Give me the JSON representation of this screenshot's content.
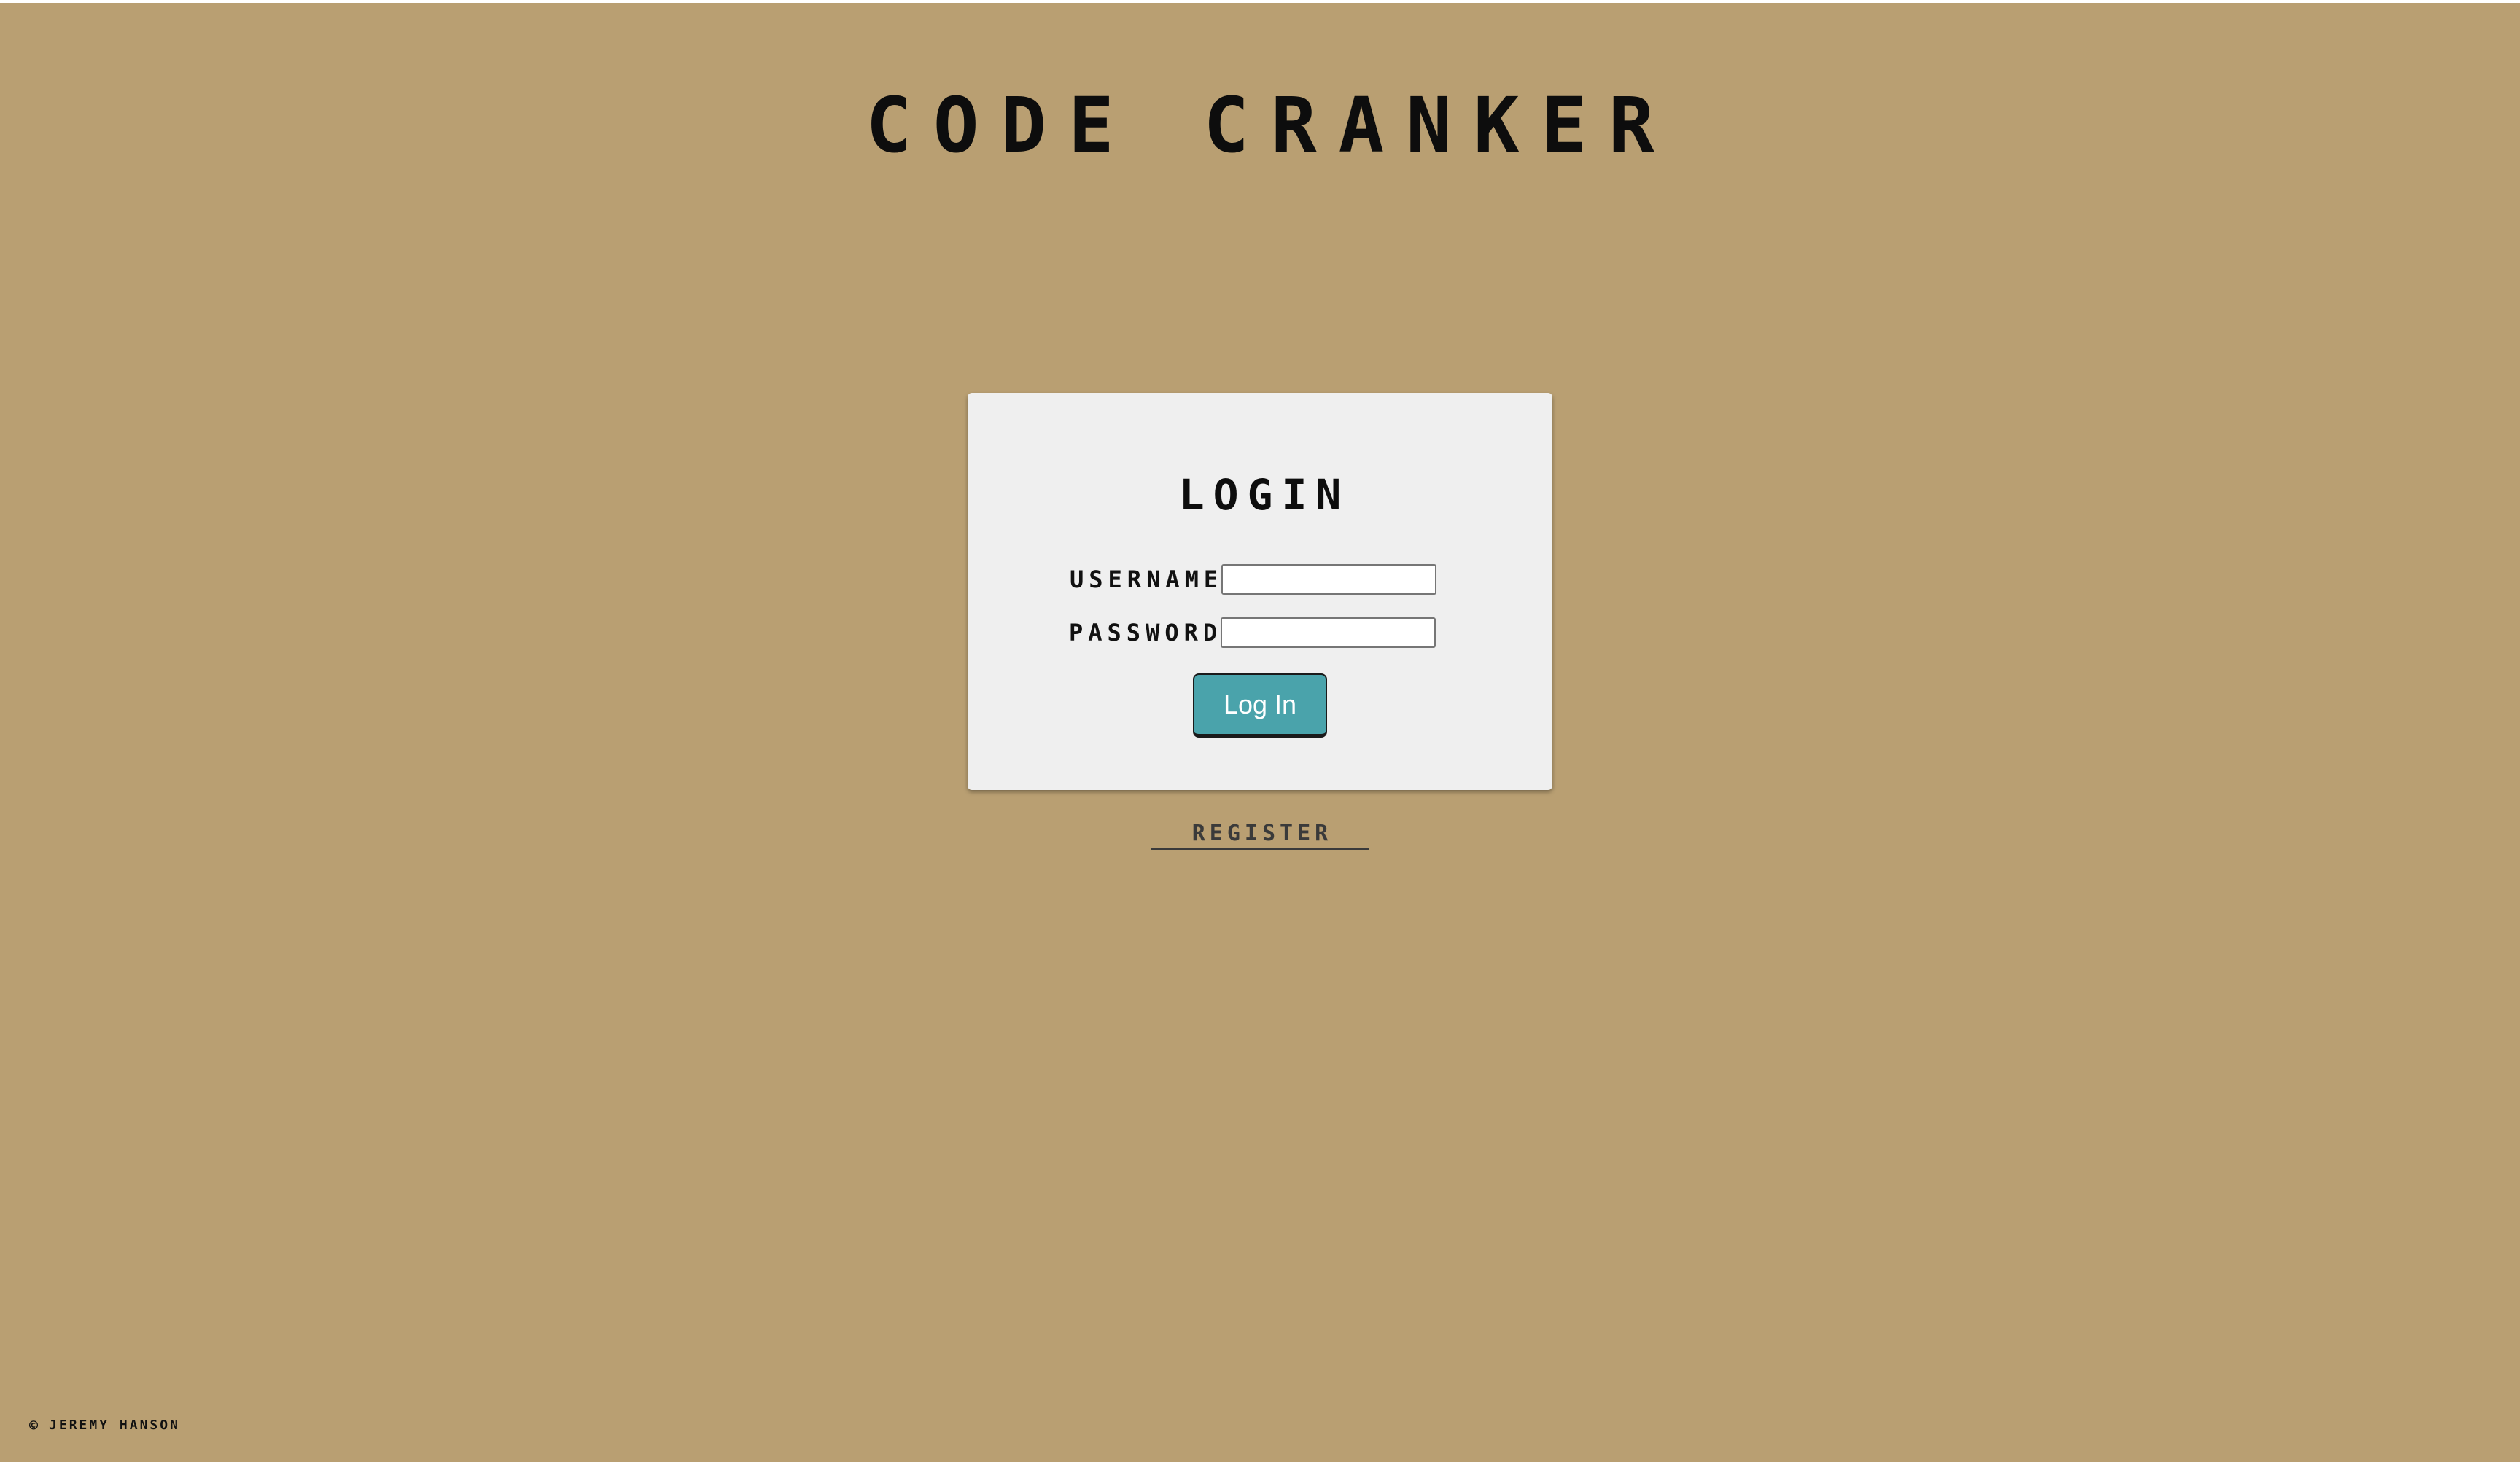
{
  "header": {
    "title": "CODE CRANKER"
  },
  "login": {
    "heading": "LOGIN",
    "username_label": "USERNAME:",
    "username_value": "",
    "password_label": "PASSWORD:",
    "password_value": "",
    "submit_label": "Log In"
  },
  "register": {
    "label": "REGISTER"
  },
  "footer": {
    "copyright_symbol": "©",
    "author": "JEREMY HANSON"
  },
  "colors": {
    "background": "#b99f72",
    "card": "#efefef",
    "button": "#4aa3ab"
  }
}
